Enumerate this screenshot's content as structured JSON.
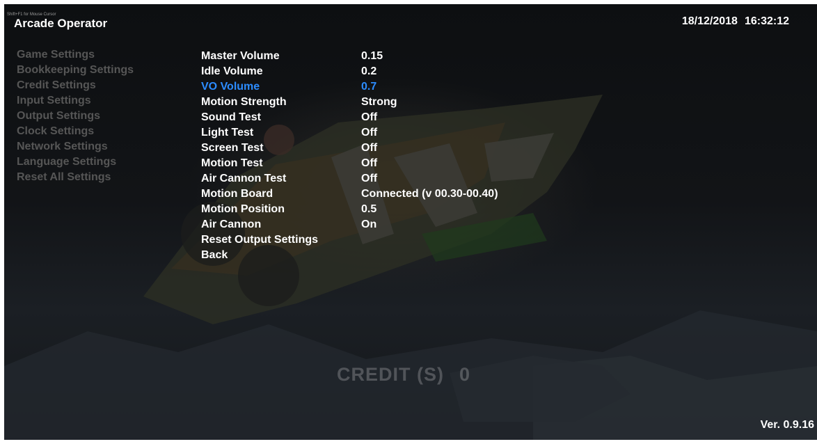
{
  "hint": "Shift+F1 for Mouse Cursor",
  "title": "Arcade Operator",
  "datetime": {
    "date": "18/12/2018",
    "time": "16:32:12"
  },
  "side_menu": [
    "Game Settings",
    "Bookkeeping Settings",
    "Credit Settings",
    "Input Settings",
    "Output Settings",
    "Clock Settings",
    "Network Settings",
    "Language Settings",
    "Reset All Settings"
  ],
  "settings": [
    {
      "label": "Master Volume",
      "value": "0.15"
    },
    {
      "label": "Idle Volume",
      "value": "0.2"
    },
    {
      "label": "VO Volume",
      "value": "0.7",
      "selected": true
    },
    {
      "label": "Motion Strength",
      "value": "Strong"
    },
    {
      "label": "Sound Test",
      "value": "Off"
    },
    {
      "label": "Light Test",
      "value": "Off"
    },
    {
      "label": "Screen Test",
      "value": "Off"
    },
    {
      "label": "Motion Test",
      "value": "Off"
    },
    {
      "label": "Air Cannon Test",
      "value": "Off"
    },
    {
      "label": "Motion Board",
      "value": "Connected (v 00.30-00.40)"
    },
    {
      "label": "Motion Position",
      "value": "0.5"
    },
    {
      "label": "Air Cannon",
      "value": "On"
    },
    {
      "label": "Reset Output Settings",
      "value": ""
    },
    {
      "label": "Back",
      "value": ""
    }
  ],
  "credit": {
    "label": "CREDIT (S)",
    "value": "0"
  },
  "version": "Ver. 0.9.16",
  "colors": {
    "text": "#ffffff",
    "selected": "#2c8cff",
    "inactive_menu": "#565656",
    "background": "#121417"
  }
}
